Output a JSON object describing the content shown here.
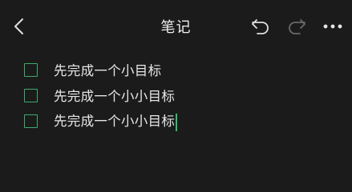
{
  "header": {
    "title": "笔记",
    "back_icon": "chevron-left-icon",
    "undo_icon": "undo-icon",
    "redo_icon": "redo-icon",
    "more_icon": "more-dots-icon"
  },
  "checklist": {
    "items": [
      {
        "text": "先完成一个小目标",
        "checked": false
      },
      {
        "text": "先完成一个小小目标",
        "checked": false
      },
      {
        "text": "先完成一个小小目标",
        "checked": false
      }
    ]
  },
  "colors": {
    "background": "#1b1b1b",
    "accent_green": "#3dab6f",
    "text": "#e6e6e6",
    "icon_active": "#e0e0e0",
    "icon_disabled": "#6a6a6a"
  }
}
